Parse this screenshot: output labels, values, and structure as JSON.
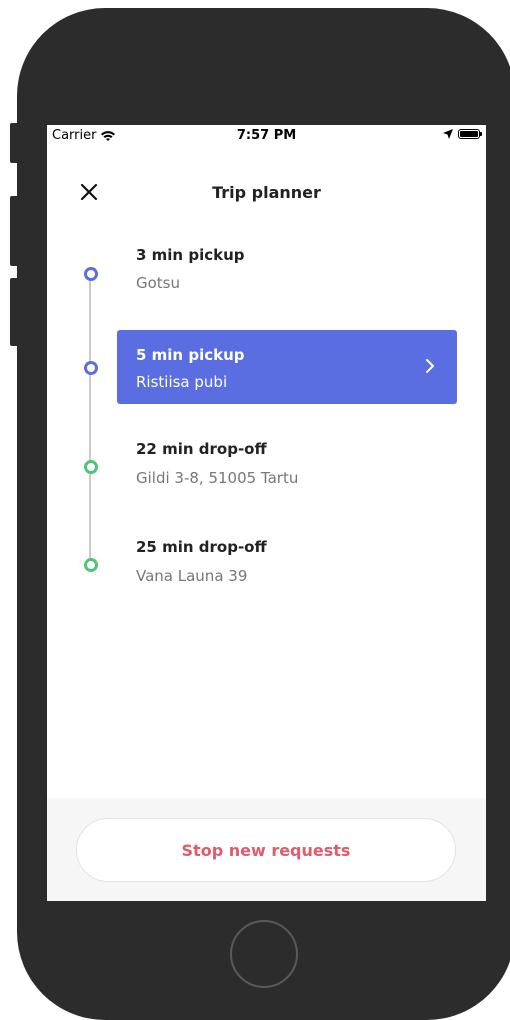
{
  "status_bar": {
    "carrier": "Carrier",
    "time": "7:57 PM"
  },
  "header": {
    "title": "Trip planner"
  },
  "stops": [
    {
      "title": "3 min pickup",
      "subtitle": "Gotsu",
      "type": "pickup",
      "active": false
    },
    {
      "title": "5 min pickup",
      "subtitle": "Ristiisa pubi",
      "type": "pickup",
      "active": true
    },
    {
      "title": "22 min drop-off",
      "subtitle": "Gildi 3-8, 51005 Tartu",
      "type": "drop-off",
      "active": false
    },
    {
      "title": "25 min drop-off",
      "subtitle": "Vana Launa 39",
      "type": "drop-off",
      "active": false
    }
  ],
  "footer": {
    "stop_requests_label": "Stop new requests"
  },
  "colors": {
    "pickup": "#5b6ee1",
    "dropoff": "#4fc57a",
    "danger": "#e35a6b"
  }
}
